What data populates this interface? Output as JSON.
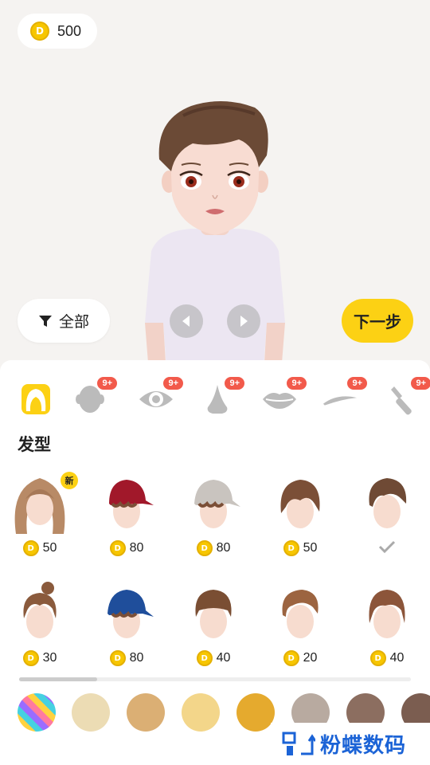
{
  "header": {
    "coin_symbol": "D",
    "coin_amount": "500"
  },
  "stage": {
    "filter_label": "全部",
    "next_label": "下一步"
  },
  "categories": [
    {
      "name": "hair",
      "badge": ""
    },
    {
      "name": "face",
      "badge": "9+"
    },
    {
      "name": "eye",
      "badge": "9+"
    },
    {
      "name": "nose",
      "badge": "9+"
    },
    {
      "name": "lips",
      "badge": "9+"
    },
    {
      "name": "eyebrow",
      "badge": "9+"
    },
    {
      "name": "makeup-brush",
      "badge": "9+"
    }
  ],
  "section": {
    "title": "发型"
  },
  "items": [
    {
      "style": "long-wavy",
      "price": "50",
      "new_tag": "新"
    },
    {
      "style": "red-cap",
      "price": "80"
    },
    {
      "style": "white-cap",
      "price": "80"
    },
    {
      "style": "messy-brown",
      "price": "50"
    },
    {
      "style": "short-swept",
      "price": "",
      "selected": true
    },
    {
      "style": "bun",
      "price": "30"
    },
    {
      "style": "blue-cap",
      "price": "80"
    },
    {
      "style": "bowl-cut",
      "price": "40"
    },
    {
      "style": "side-part",
      "price": "20"
    },
    {
      "style": "slicked-back",
      "price": "40"
    }
  ],
  "colors": {
    "accent": "#fcd114",
    "swatches": [
      "rainbow",
      "#ecdcb4",
      "#dbaf74",
      "#f3d68a",
      "#e5aa2e",
      "#b8aaa0",
      "#8c6e60",
      "#7b5d50"
    ]
  },
  "watermark": {
    "text": "粉蝶数码"
  }
}
